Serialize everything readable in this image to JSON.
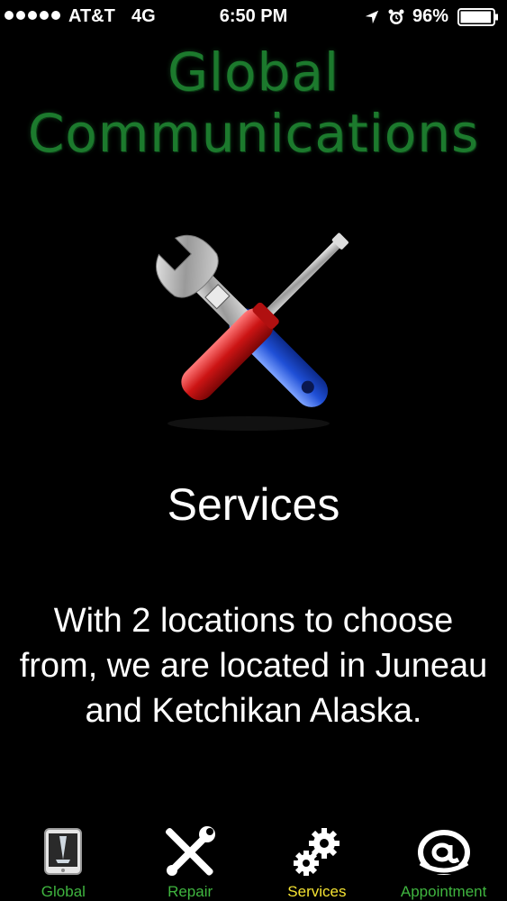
{
  "status_bar": {
    "carrier": "AT&T",
    "network": "4G",
    "time": "6:50 PM",
    "battery": "96%",
    "battery_level": 0.96,
    "icons": [
      "signal-dots",
      "location-arrow-icon",
      "alarm-icon",
      "battery-icon"
    ]
  },
  "header": {
    "title_line1": "Global",
    "title_line2": "Communications",
    "title_color": "#1c7a2d"
  },
  "main": {
    "hero_icon": "wrench-screwdriver-icon",
    "heading": "Services",
    "description": "With 2 locations to choose from, we are located in Juneau and Ketchikan Alaska."
  },
  "tab_bar": {
    "label_color": "#3fb53f",
    "active_label_color": "#f5e332",
    "tabs": [
      {
        "label": "Global",
        "icon": "tablet-icon",
        "active": false
      },
      {
        "label": "Repair",
        "icon": "tools-icon",
        "active": false
      },
      {
        "label": "Services",
        "icon": "gears-icon",
        "active": true
      },
      {
        "label": "Appointment",
        "icon": "at-sign-icon",
        "active": false
      }
    ]
  }
}
